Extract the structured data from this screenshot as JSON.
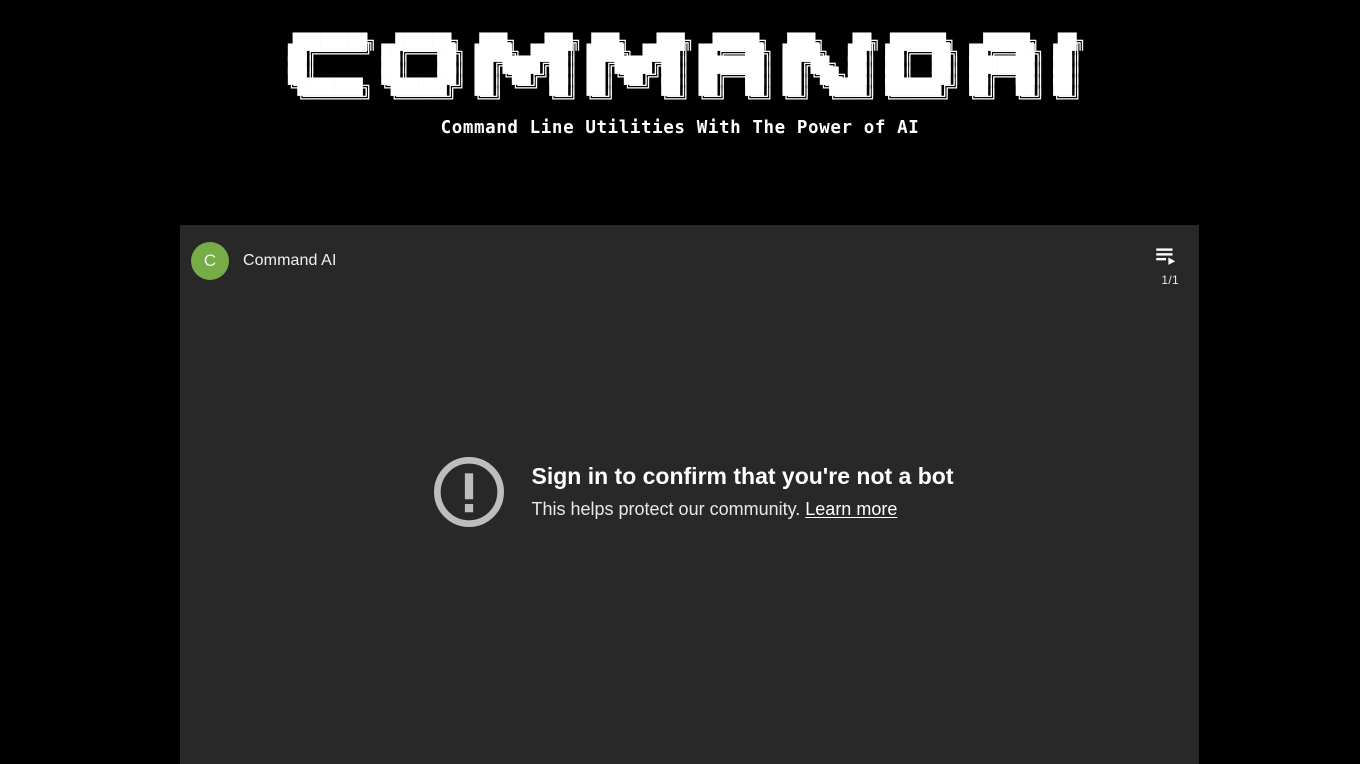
{
  "page": {
    "background_color": "#000000"
  },
  "header": {
    "logo_text": "COMMANDAI",
    "logo_ascii": "                                                                                                                 \n  ████████╗  ██████╗  ███╗   ███╗ ███╗   ███╗  █████╗  ███╗   ██╗ ██████╗   █████╗  ██╗\n ██╔═════╝ ██╔═══██╗ ████╗ ████║ ████╗ ████║ ██╔══██╗ ████╗  ██║ ██╔══██╗ ██╔══██╗ ██║\n ██║       ██║   ██║ ██╔████╔██║ ██╔████╔██║ ███████║ ██╔██╗ ██║ ██║  ██║ ███████║ ██║\n ██║       ██║   ██║ ██║╚██╔╝██║ ██║╚██╔╝██║ ██╔══██║ ██║╚██╗██║ ██║  ██║ ██╔══██║ ██║\n ╚███████╗ ╚██████╔╝ ██║ ╚═╝ ██║ ██║ ╚═╝ ██║ ██║  ██║ ██║ ╚████║ ██████╔╝ ██║  ██║ ██║\n  ╚══════╝  ╚═════╝  ╚═╝     ╚═╝ ╚═╝     ╚═╝ ╚═╝  ╚═╝ ╚═╝  ╚═══╝ ╚═════╝  ╚═╝  ╚═╝ ╚═╝",
    "tagline": "Command Line Utilities With The Power of AI",
    "logo_color": "#ffffff",
    "tagline_color": "#ffffff"
  },
  "player": {
    "background_color": "#282828",
    "channel": {
      "avatar_letter": "C",
      "avatar_color": "#76ad46",
      "name": "Command AI"
    },
    "playlist": {
      "icon": "playlist-play-icon",
      "count": "1/1"
    },
    "error": {
      "icon": "alert-circle-icon",
      "icon_color": "#bdbdbd",
      "title": "Sign in to confirm that you're not a bot",
      "subtitle": "This helps protect our community.",
      "link_label": "Learn more"
    }
  }
}
